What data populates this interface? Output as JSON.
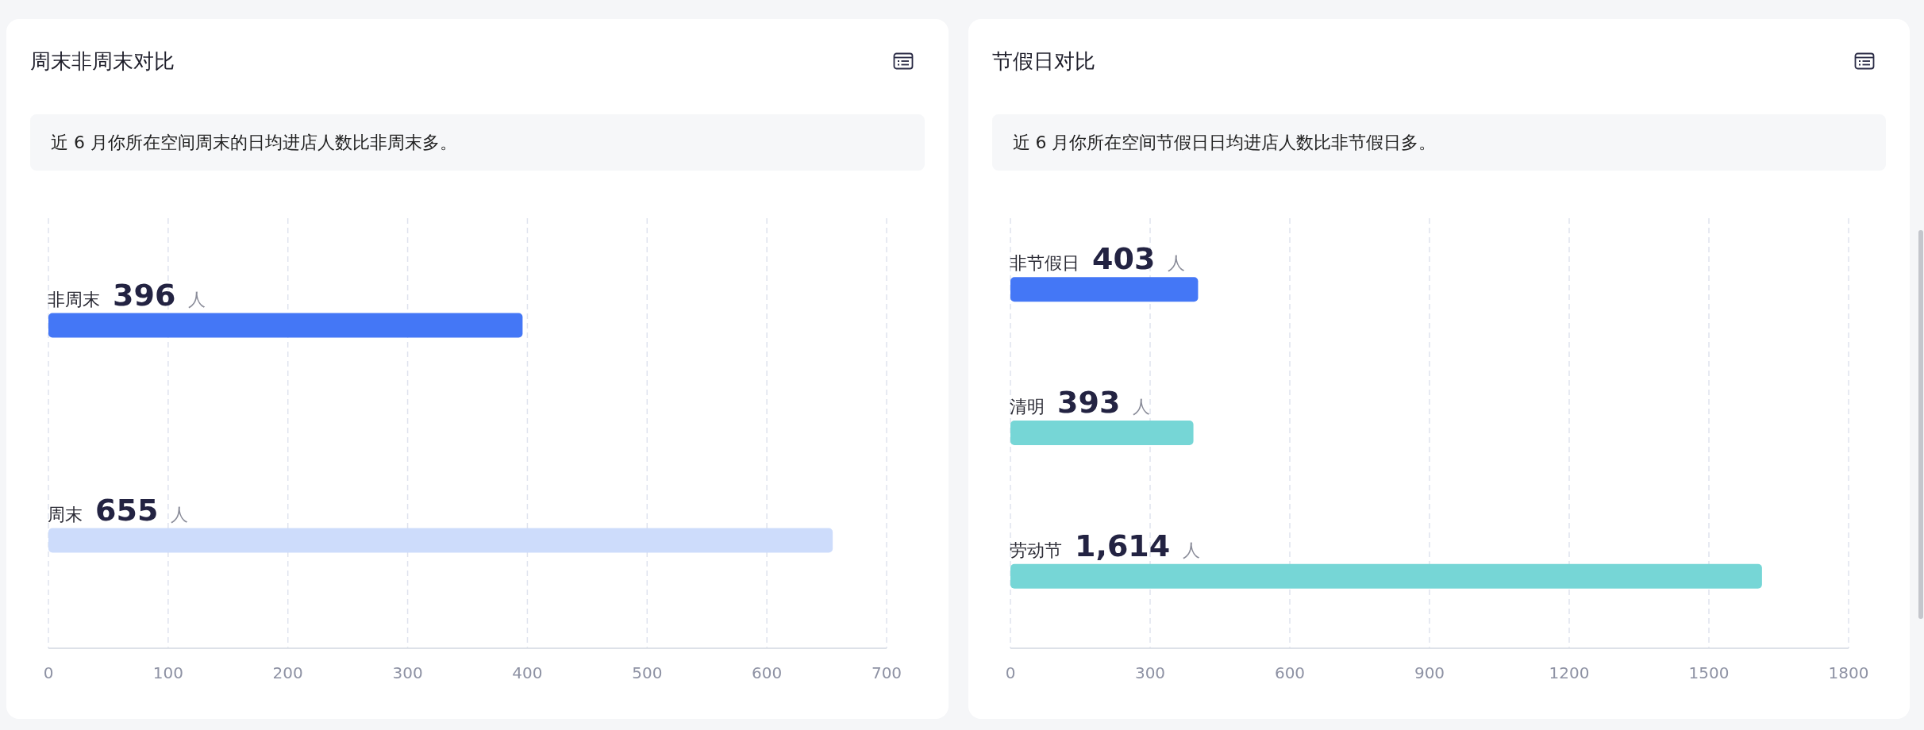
{
  "cards": [
    {
      "title": "周末非周末对比",
      "note": "近 6 月你所在空间周末的日均进店人数比非周末多。",
      "bars": [
        {
          "unit": "人",
          "color": "#4477f6"
        },
        {
          "unit": "人",
          "color": "#cddcfb"
        }
      ],
      "chart_data": {
        "type": "bar",
        "orientation": "horizontal",
        "categories": [
          "非周末",
          "周末"
        ],
        "series": [
          {
            "values": [
              396,
              655
            ]
          }
        ],
        "value_labels": [
          "396",
          "655"
        ],
        "xlim": [
          0,
          700
        ],
        "xticks": [
          0,
          100,
          200,
          300,
          400,
          500,
          600,
          700
        ],
        "grid": true
      }
    },
    {
      "title": "节假日对比",
      "note": "近 6 月你所在空间节假日日均进店人数比非节假日多。",
      "bars": [
        {
          "unit": "人",
          "color": "#4477f6"
        },
        {
          "unit": "人",
          "color": "#76d6d6"
        },
        {
          "unit": "人",
          "color": "#76d6d6"
        }
      ],
      "chart_data": {
        "type": "bar",
        "orientation": "horizontal",
        "categories": [
          "非节假日",
          "清明",
          "劳动节"
        ],
        "series": [
          {
            "values": [
              403,
              393,
              1614
            ]
          }
        ],
        "value_labels": [
          "403",
          "393",
          "1,614"
        ],
        "xlim": [
          0,
          1800
        ],
        "xticks": [
          0,
          300,
          600,
          900,
          1200,
          1500,
          1800
        ],
        "grid": true
      }
    }
  ]
}
